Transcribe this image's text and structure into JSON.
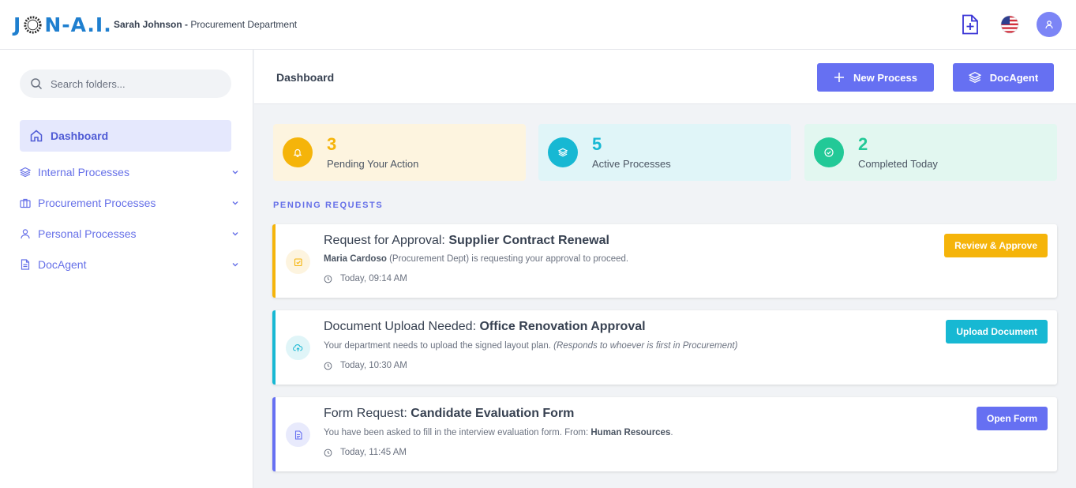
{
  "header": {
    "logo_prefix": "J",
    "logo_suffix": "N-A.I.",
    "user_name": "Sarah Johnson -",
    "department": "Procurement Department",
    "icons": [
      "add-document-icon",
      "us-flag-icon",
      "user-avatar-icon"
    ]
  },
  "sidebar": {
    "search_placeholder": "Search folders...",
    "active_item": {
      "label": "Dashboard",
      "icon": "home-icon"
    },
    "items": [
      {
        "label": "Internal Processes",
        "icon": "layers-icon"
      },
      {
        "label": "Procurement Processes",
        "icon": "briefcase-icon"
      },
      {
        "label": "Personal Processes",
        "icon": "user-icon"
      },
      {
        "label": "DocAgent",
        "icon": "document-icon"
      }
    ]
  },
  "main": {
    "title": "Dashboard",
    "new_process_label": "New Process",
    "docagent_label": "DocAgent"
  },
  "stats": [
    {
      "value": "3",
      "label": "Pending Your Action",
      "color": "#f5b40a",
      "bg": "#fdf4df",
      "icon": "bell-icon"
    },
    {
      "value": "5",
      "label": "Active Processes",
      "color": "#17b8d3",
      "bg": "#e0f5f8",
      "icon": "layers-icon"
    },
    {
      "value": "2",
      "label": "Completed Today",
      "color": "#22c997",
      "bg": "#e2f7f0",
      "icon": "check-circle-icon"
    }
  ],
  "pending": {
    "section_title": "PENDING REQUESTS",
    "requests": [
      {
        "title_prefix": "Request for Approval:",
        "title_bold": "Supplier Contract Renewal",
        "desc_bold": "Maria Cardoso",
        "desc": " (Procurement Dept) is requesting your approval to proceed.",
        "time": "Today, 09:14 AM",
        "button": "Review & Approve",
        "color": "#f5b40a",
        "icon": "edit-check-icon"
      },
      {
        "title_prefix": "Document Upload Needed:",
        "title_bold": "Office Renovation Approval",
        "desc": "Your department needs to upload the signed layout plan. ",
        "desc_italic": "(Responds to whoever is first in Procurement)",
        "time": "Today, 10:30 AM",
        "button": "Upload Document",
        "color": "#17b8d3",
        "icon": "cloud-upload-icon"
      },
      {
        "title_prefix": "Form Request:",
        "title_bold": "Candidate Evaluation Form",
        "desc": "You have been asked to fill in the interview evaluation form. From: ",
        "desc_bold": "Human Resources",
        "desc_end": ".",
        "time": "Today, 11:45 AM",
        "button": "Open Form",
        "color": "#6670f2",
        "icon": "form-icon"
      }
    ]
  }
}
